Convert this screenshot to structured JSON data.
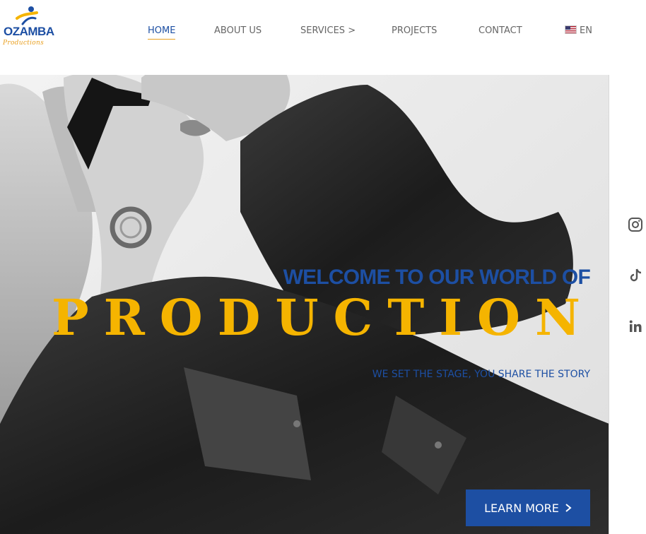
{
  "brand": {
    "name": "OZAMBA",
    "sub": "Productions",
    "primary_color": "#1d4fa3",
    "accent_color": "#f5b400"
  },
  "nav": {
    "items": [
      {
        "label": "HOME",
        "active": true
      },
      {
        "label": "ABOUT US"
      },
      {
        "label": "SERVICES >"
      },
      {
        "label": "PROJECTS"
      },
      {
        "label": "CONTACT"
      }
    ],
    "language": {
      "label": "EN",
      "flag": "us-flag-icon"
    }
  },
  "hero": {
    "headline": "WELCOME TO OUR WORLD OF",
    "big_word": "PRODUCTION",
    "tagline": "WE SET THE STAGE, YOU SHARE THE STORY",
    "cta_label": "LEARN MORE",
    "cta_icon": "chevron-right-icon",
    "image": "black-and-white photo of woman in sunglasses and leather jacket looking up"
  },
  "social": [
    {
      "icon": "instagram-icon"
    },
    {
      "icon": "tiktok-icon"
    },
    {
      "icon": "linkedin-icon"
    }
  ]
}
